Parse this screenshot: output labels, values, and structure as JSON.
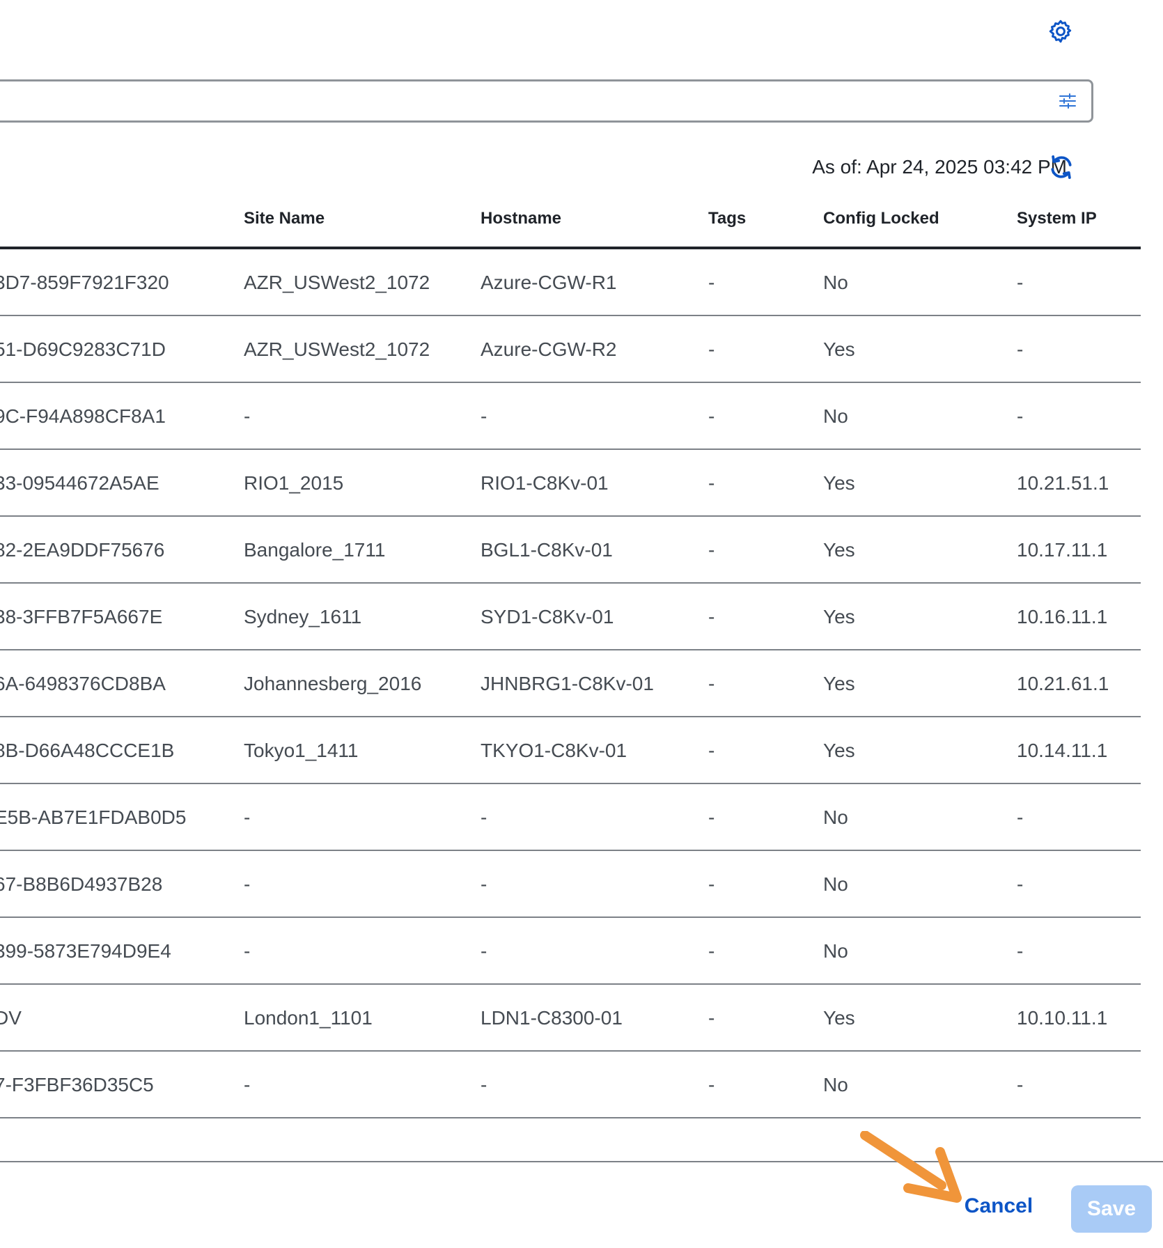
{
  "toolbar": {
    "settings_icon": "gear-icon"
  },
  "search": {
    "value": "",
    "placeholder": "",
    "filter_icon": "sliders-icon"
  },
  "status": {
    "as_of": "As of: Apr 24, 2025 03:42 PM",
    "refresh_icon": "refresh-icon"
  },
  "colors": {
    "accent": "#0d55c6",
    "save_disabled": "#a9cbf6",
    "annotation": "#f0953a"
  },
  "table": {
    "headers": [
      "",
      "Site Name",
      "Hostname",
      "Tags",
      "Config Locked",
      "System IP"
    ],
    "rows": [
      {
        "uuid": "3D7-859F7921F320",
        "site": "AZR_USWest2_1072",
        "host": "Azure-CGW-R1",
        "tags": "-",
        "locked": "No",
        "ip": "-"
      },
      {
        "uuid": "51-D69C9283C71D",
        "site": "AZR_USWest2_1072",
        "host": "Azure-CGW-R2",
        "tags": "-",
        "locked": "Yes",
        "ip": "-"
      },
      {
        "uuid": "9C-F94A898CF8A1",
        "site": "-",
        "host": "-",
        "tags": "-",
        "locked": "No",
        "ip": "-"
      },
      {
        "uuid": "33-09544672A5AE",
        "site": "RIO1_2015",
        "host": "RIO1-C8Kv-01",
        "tags": "-",
        "locked": "Yes",
        "ip": "10.21.51.1"
      },
      {
        "uuid": "82-2EA9DDF75676",
        "site": "Bangalore_1711",
        "host": "BGL1-C8Kv-01",
        "tags": "-",
        "locked": "Yes",
        "ip": "10.17.11.1"
      },
      {
        "uuid": "38-3FFB7F5A667E",
        "site": "Sydney_1611",
        "host": "SYD1-C8Kv-01",
        "tags": "-",
        "locked": "Yes",
        "ip": "10.16.11.1"
      },
      {
        "uuid": "6A-6498376CD8BA",
        "site": "Johannesberg_2016",
        "host": "JHNBRG1-C8Kv-01",
        "tags": "-",
        "locked": "Yes",
        "ip": "10.21.61.1"
      },
      {
        "uuid": "8B-D66A48CCCE1B",
        "site": "Tokyo1_1411",
        "host": "TKYO1-C8Kv-01",
        "tags": "-",
        "locked": "Yes",
        "ip": "10.14.11.1"
      },
      {
        "uuid": "E5B-AB7E1FDAB0D5",
        "site": "-",
        "host": "-",
        "tags": "-",
        "locked": "No",
        "ip": "-"
      },
      {
        "uuid": "67-B8B6D4937B28",
        "site": "-",
        "host": "-",
        "tags": "-",
        "locked": "No",
        "ip": "-"
      },
      {
        "uuid": "399-5873E794D9E4",
        "site": "-",
        "host": "-",
        "tags": "-",
        "locked": "No",
        "ip": "-"
      },
      {
        "uuid": "DV",
        "site": "London1_1101",
        "host": "LDN1-C8300-01",
        "tags": "-",
        "locked": "Yes",
        "ip": "10.10.11.1"
      },
      {
        "uuid": "7-F3FBF36D35C5",
        "site": "-",
        "host": "-",
        "tags": "-",
        "locked": "No",
        "ip": "-"
      }
    ]
  },
  "footer": {
    "cancel_label": "Cancel",
    "save_label": "Save",
    "arrow_icon": "annotation-arrow-icon"
  }
}
